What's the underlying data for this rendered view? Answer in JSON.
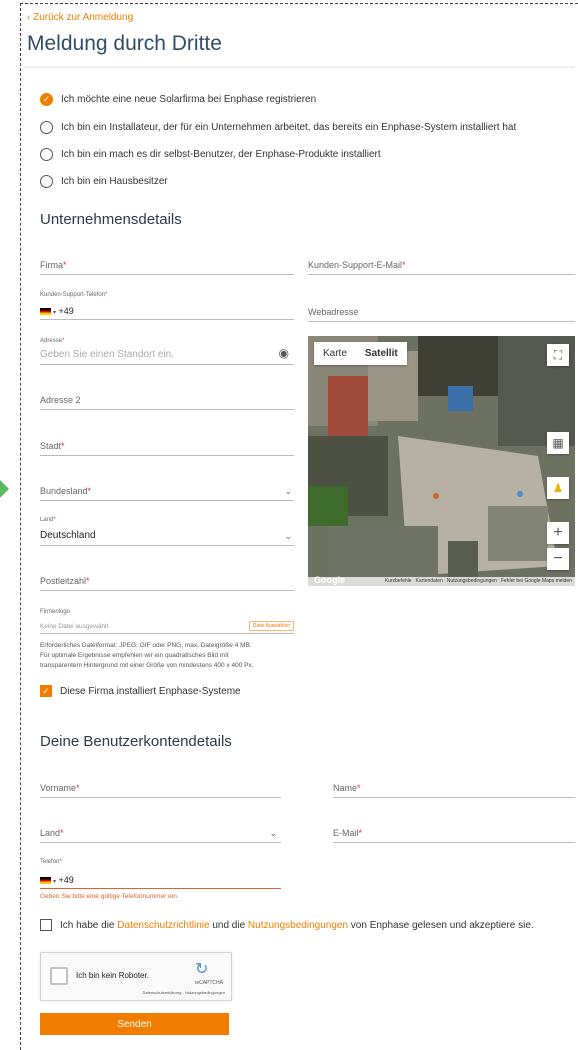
{
  "nav": {
    "back_label": "Zurück zur Anmeldung"
  },
  "page": {
    "title": "Meldung durch Dritte"
  },
  "roles": [
    {
      "label": "Ich möchte eine neue Solarfirma bei Enphase registrieren",
      "selected": true
    },
    {
      "label": "Ich bin ein Installateur, der für ein Unternehmen arbeitet, das bereits ein Enphase-System installiert hat",
      "selected": false
    },
    {
      "label": "Ich bin ein mach es dir selbst-Benutzer, der Enphase-Produkte installiert",
      "selected": false
    },
    {
      "label": "Ich bin ein Hausbesitzer",
      "selected": false
    }
  ],
  "company": {
    "title": "Unternehmensdetails",
    "firma_label": "Firma",
    "support_email_label": "Kunden-Support-E-Mail",
    "support_phone_label": "Kunden-Support-Telefon",
    "phone_prefix": "+49",
    "website_label": "Webadresse",
    "address_label": "Adresse",
    "address_placeholder": "Geben Sie einen Standort ein.",
    "address2_label": "Adresse 2",
    "city_label": "Stadt",
    "state_label": "Bundesland",
    "country_label": "Land",
    "country_value": "Deutschland",
    "zip_label": "Postleitzahl",
    "logo_label": "Firmenlogo",
    "logo_value": "Keine Datei ausgewählt",
    "logo_button": "Datei Auswählen",
    "logo_hint_1": "Erforderliches Dateiformat: JPEG, GIF oder PNG, max. Dateigröße 4 MB.",
    "logo_hint_2": "Für optimale Ergebnisse empfehlen wir ein quadratisches Bild mit",
    "logo_hint_3": "transparentem Hintergrund mit einer Größe von mindestens 400 x 400 Px.",
    "installs_label": "Diese Firma installiert Enphase-Systeme",
    "installs_checked": true
  },
  "map": {
    "tab_map": "Karte",
    "tab_satellite": "Satellit",
    "google": "Google",
    "footer_items": [
      "Kurzbefehle",
      "Kartendaten",
      "Nutzungsbedingungen",
      "Fehler bei Google Maps melden"
    ]
  },
  "account": {
    "title": "Deine Benutzerkontendetails",
    "first_name_label": "Vorname",
    "last_name_label": "Name",
    "country_label": "Land",
    "email_label": "E-Mail",
    "phone_label": "Telefon",
    "phone_prefix": "+49",
    "phone_error": "Geben Sie bitte eine gültige Telefonnummer ein."
  },
  "terms": {
    "prefix": "Ich habe die",
    "privacy_link": "Datenschutzrichtlinie",
    "middle": "und die",
    "terms_link": "Nutzungsbedingungen",
    "suffix": "von Enphase gelesen und akzeptiere sie."
  },
  "captcha": {
    "label": "Ich bin kein Roboter.",
    "brand": "reCAPTCHA",
    "links": "Datenschutzerklärung - Nutzungsbedingungen"
  },
  "submit_label": "Senden",
  "colors": {
    "accent": "#f07d00",
    "title": "#2f4d6a",
    "required": "#e03030"
  },
  "required_mark": "*"
}
